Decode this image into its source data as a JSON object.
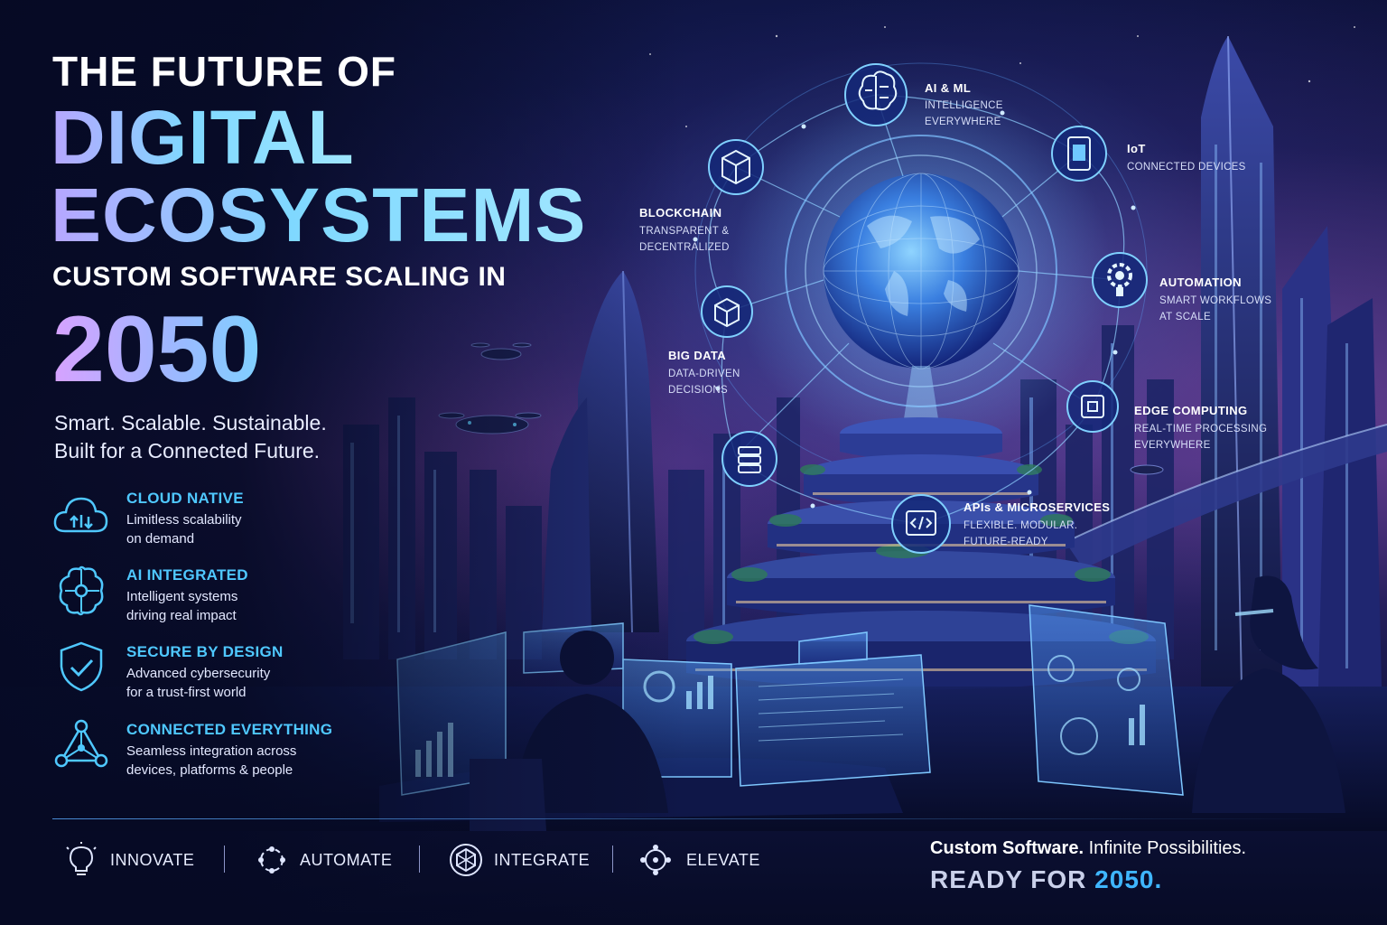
{
  "headline": {
    "line1": "THE FUTURE OF",
    "line2": "DIGITAL",
    "line3": "ECOSYSTEMS",
    "subtitle": "CUSTOM SOFTWARE SCALING IN",
    "year": "2050"
  },
  "tagline": {
    "line1": "Smart. Scalable. Sustainable.",
    "line2": "Built for a Connected Future."
  },
  "features": [
    {
      "icon": "cloud-icon",
      "title": "CLOUD NATIVE",
      "line1": "Limitless scalability",
      "line2": "on demand"
    },
    {
      "icon": "brain-icon",
      "title": "AI INTEGRATED",
      "line1": "Intelligent systems",
      "line2": "driving real impact"
    },
    {
      "icon": "shield-icon",
      "title": "SECURE BY DESIGN",
      "line1": "Advanced cybersecurity",
      "line2": "for a trust-first world"
    },
    {
      "icon": "network-icon",
      "title": "CONNECTED EVERYTHING",
      "line1": "Seamless integration across",
      "line2": "devices, platforms & people"
    }
  ],
  "nodes": {
    "ai_ml": {
      "title": "AI & ML",
      "line1": "INTELLIGENCE",
      "line2": "EVERYWHERE"
    },
    "iot": {
      "title": "IoT",
      "line1": "CONNECTED DEVICES"
    },
    "blockchain": {
      "title": "BLOCKCHAIN",
      "line1": "TRANSPARENT &",
      "line2": "DECENTRALIZED"
    },
    "automation": {
      "title": "AUTOMATION",
      "line1": "SMART WORKFLOWS",
      "line2": "AT SCALE"
    },
    "big_data": {
      "title": "BIG DATA",
      "line1": "DATA-DRIVEN",
      "line2": "DECISIONS"
    },
    "edge": {
      "title": "EDGE COMPUTING",
      "line1": "REAL-TIME PROCESSING",
      "line2": "EVERYWHERE"
    },
    "apis": {
      "title": "APIs & MICROSERVICES",
      "line1": "FLEXIBLE. MODULAR.",
      "line2": "FUTURE-READY"
    }
  },
  "pillars": [
    "INNOVATE",
    "AUTOMATE",
    "INTEGRATE",
    "ELEVATE"
  ],
  "closing": {
    "line1_bold": "Custom Software.",
    "line1_rest": " Infinite Possibilities.",
    "line2_main": "READY FOR ",
    "line2_accent": "2050."
  },
  "colors": {
    "accent_cyan": "#4fc8ff",
    "accent_blue": "#3fb6ff",
    "node_glow": "#5fb8ff",
    "background": "#070b26"
  }
}
